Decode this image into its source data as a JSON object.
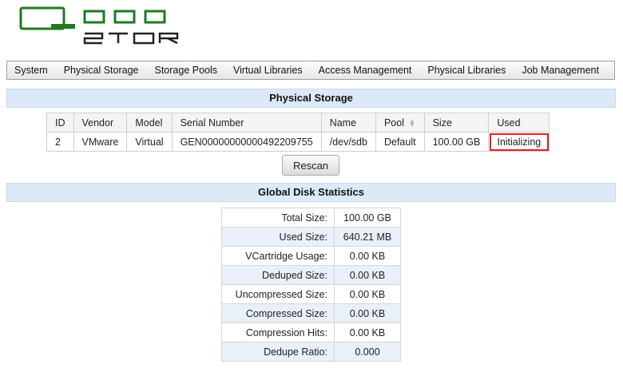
{
  "logo": {
    "text_top": "QUAD",
    "text_bottom": "STOR"
  },
  "nav": {
    "items": [
      "System",
      "Physical Storage",
      "Storage Pools",
      "Virtual Libraries",
      "Access Management",
      "Physical Libraries",
      "Job Management"
    ]
  },
  "physical_storage": {
    "title": "Physical Storage",
    "columns": [
      "ID",
      "Vendor",
      "Model",
      "Serial Number",
      "Name",
      "Pool",
      "Size",
      "Used"
    ],
    "rows": [
      [
        "2",
        "VMware",
        "Virtual",
        "GEN00000000000492209755",
        "/dev/sdb",
        "Default",
        "100.00 GB",
        "Initializing"
      ]
    ],
    "rescan_label": "Rescan"
  },
  "global_stats": {
    "title": "Global Disk Statistics",
    "rows": [
      {
        "label": "Total Size:",
        "value": "100.00 GB"
      },
      {
        "label": "Used Size:",
        "value": "640.21 MB"
      },
      {
        "label": "VCartridge Usage:",
        "value": "0.00 KB"
      },
      {
        "label": "Deduped Size:",
        "value": "0.00 KB"
      },
      {
        "label": "Uncompressed Size:",
        "value": "0.00 KB"
      },
      {
        "label": "Compressed Size:",
        "value": "0.00 KB"
      },
      {
        "label": "Compression Hits:",
        "value": "0.00 KB"
      },
      {
        "label": "Dedupe Ratio:",
        "value": "0.000"
      }
    ]
  },
  "colors": {
    "logo_green": "#1f7a1f",
    "header_bg": "#dce9f7",
    "highlight_red": "#dd2222"
  }
}
